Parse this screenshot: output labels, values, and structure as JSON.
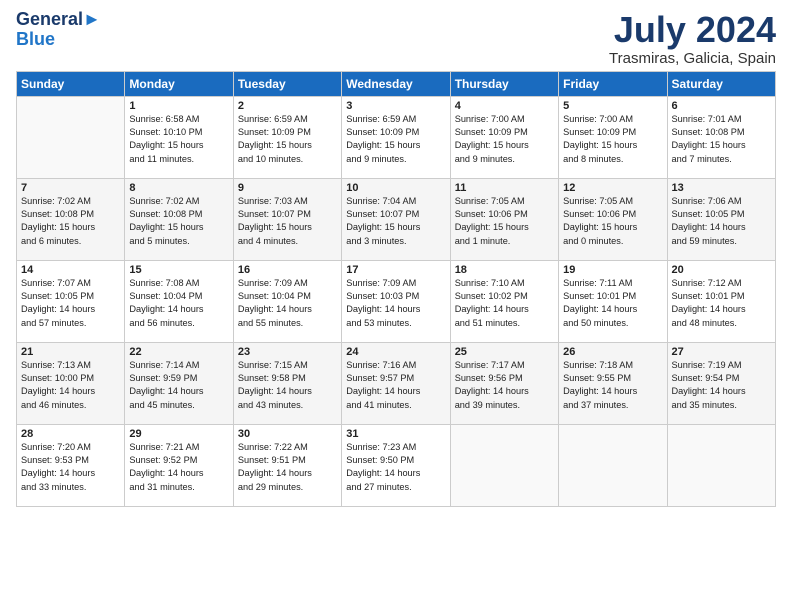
{
  "header": {
    "logo_line1": "General",
    "logo_line2": "Blue",
    "month": "July 2024",
    "location": "Trasmiras, Galicia, Spain"
  },
  "weekdays": [
    "Sunday",
    "Monday",
    "Tuesday",
    "Wednesday",
    "Thursday",
    "Friday",
    "Saturday"
  ],
  "weeks": [
    [
      {
        "day": "",
        "info": ""
      },
      {
        "day": "1",
        "info": "Sunrise: 6:58 AM\nSunset: 10:10 PM\nDaylight: 15 hours\nand 11 minutes."
      },
      {
        "day": "2",
        "info": "Sunrise: 6:59 AM\nSunset: 10:09 PM\nDaylight: 15 hours\nand 10 minutes."
      },
      {
        "day": "3",
        "info": "Sunrise: 6:59 AM\nSunset: 10:09 PM\nDaylight: 15 hours\nand 9 minutes."
      },
      {
        "day": "4",
        "info": "Sunrise: 7:00 AM\nSunset: 10:09 PM\nDaylight: 15 hours\nand 9 minutes."
      },
      {
        "day": "5",
        "info": "Sunrise: 7:00 AM\nSunset: 10:09 PM\nDaylight: 15 hours\nand 8 minutes."
      },
      {
        "day": "6",
        "info": "Sunrise: 7:01 AM\nSunset: 10:08 PM\nDaylight: 15 hours\nand 7 minutes."
      }
    ],
    [
      {
        "day": "7",
        "info": "Sunrise: 7:02 AM\nSunset: 10:08 PM\nDaylight: 15 hours\nand 6 minutes."
      },
      {
        "day": "8",
        "info": "Sunrise: 7:02 AM\nSunset: 10:08 PM\nDaylight: 15 hours\nand 5 minutes."
      },
      {
        "day": "9",
        "info": "Sunrise: 7:03 AM\nSunset: 10:07 PM\nDaylight: 15 hours\nand 4 minutes."
      },
      {
        "day": "10",
        "info": "Sunrise: 7:04 AM\nSunset: 10:07 PM\nDaylight: 15 hours\nand 3 minutes."
      },
      {
        "day": "11",
        "info": "Sunrise: 7:05 AM\nSunset: 10:06 PM\nDaylight: 15 hours\nand 1 minute."
      },
      {
        "day": "12",
        "info": "Sunrise: 7:05 AM\nSunset: 10:06 PM\nDaylight: 15 hours\nand 0 minutes."
      },
      {
        "day": "13",
        "info": "Sunrise: 7:06 AM\nSunset: 10:05 PM\nDaylight: 14 hours\nand 59 minutes."
      }
    ],
    [
      {
        "day": "14",
        "info": "Sunrise: 7:07 AM\nSunset: 10:05 PM\nDaylight: 14 hours\nand 57 minutes."
      },
      {
        "day": "15",
        "info": "Sunrise: 7:08 AM\nSunset: 10:04 PM\nDaylight: 14 hours\nand 56 minutes."
      },
      {
        "day": "16",
        "info": "Sunrise: 7:09 AM\nSunset: 10:04 PM\nDaylight: 14 hours\nand 55 minutes."
      },
      {
        "day": "17",
        "info": "Sunrise: 7:09 AM\nSunset: 10:03 PM\nDaylight: 14 hours\nand 53 minutes."
      },
      {
        "day": "18",
        "info": "Sunrise: 7:10 AM\nSunset: 10:02 PM\nDaylight: 14 hours\nand 51 minutes."
      },
      {
        "day": "19",
        "info": "Sunrise: 7:11 AM\nSunset: 10:01 PM\nDaylight: 14 hours\nand 50 minutes."
      },
      {
        "day": "20",
        "info": "Sunrise: 7:12 AM\nSunset: 10:01 PM\nDaylight: 14 hours\nand 48 minutes."
      }
    ],
    [
      {
        "day": "21",
        "info": "Sunrise: 7:13 AM\nSunset: 10:00 PM\nDaylight: 14 hours\nand 46 minutes."
      },
      {
        "day": "22",
        "info": "Sunrise: 7:14 AM\nSunset: 9:59 PM\nDaylight: 14 hours\nand 45 minutes."
      },
      {
        "day": "23",
        "info": "Sunrise: 7:15 AM\nSunset: 9:58 PM\nDaylight: 14 hours\nand 43 minutes."
      },
      {
        "day": "24",
        "info": "Sunrise: 7:16 AM\nSunset: 9:57 PM\nDaylight: 14 hours\nand 41 minutes."
      },
      {
        "day": "25",
        "info": "Sunrise: 7:17 AM\nSunset: 9:56 PM\nDaylight: 14 hours\nand 39 minutes."
      },
      {
        "day": "26",
        "info": "Sunrise: 7:18 AM\nSunset: 9:55 PM\nDaylight: 14 hours\nand 37 minutes."
      },
      {
        "day": "27",
        "info": "Sunrise: 7:19 AM\nSunset: 9:54 PM\nDaylight: 14 hours\nand 35 minutes."
      }
    ],
    [
      {
        "day": "28",
        "info": "Sunrise: 7:20 AM\nSunset: 9:53 PM\nDaylight: 14 hours\nand 33 minutes."
      },
      {
        "day": "29",
        "info": "Sunrise: 7:21 AM\nSunset: 9:52 PM\nDaylight: 14 hours\nand 31 minutes."
      },
      {
        "day": "30",
        "info": "Sunrise: 7:22 AM\nSunset: 9:51 PM\nDaylight: 14 hours\nand 29 minutes."
      },
      {
        "day": "31",
        "info": "Sunrise: 7:23 AM\nSunset: 9:50 PM\nDaylight: 14 hours\nand 27 minutes."
      },
      {
        "day": "",
        "info": ""
      },
      {
        "day": "",
        "info": ""
      },
      {
        "day": "",
        "info": ""
      }
    ]
  ]
}
